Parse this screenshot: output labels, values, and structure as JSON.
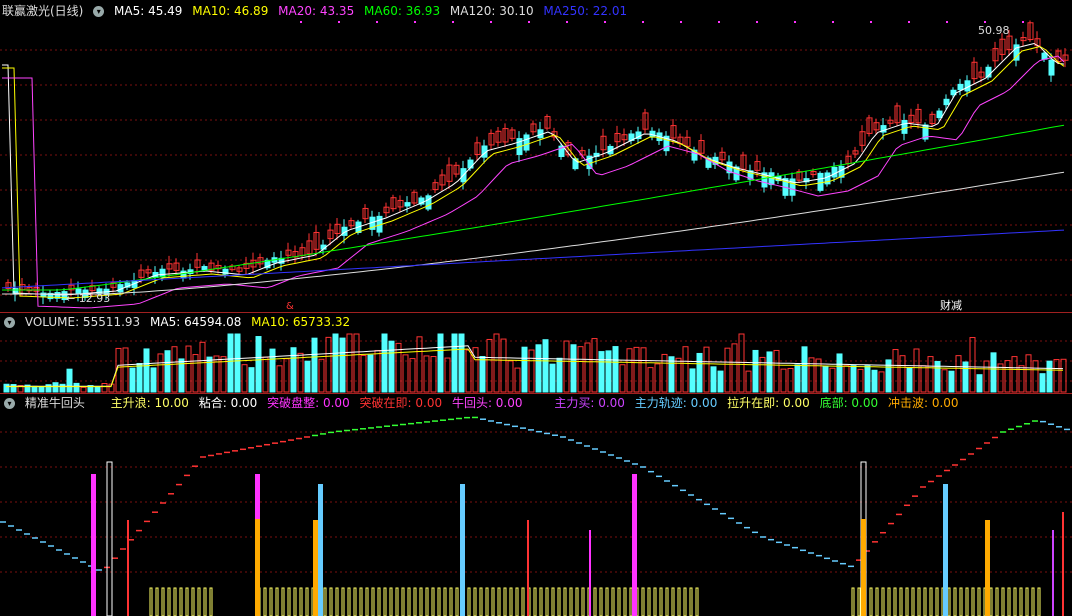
{
  "price_panel": {
    "title": "联赢激光(日线)",
    "ma": [
      {
        "label": "MA5: 45.49",
        "color": "#ffffff"
      },
      {
        "label": "MA10: 46.89",
        "color": "#ffff00"
      },
      {
        "label": "MA20: 43.35",
        "color": "#ff44ff"
      },
      {
        "label": "MA60: 36.93",
        "color": "#00ff00"
      },
      {
        "label": "MA120: 30.10",
        "color": "#dddddd"
      },
      {
        "label": "MA250: 22.01",
        "color": "#3333ff"
      }
    ],
    "high_label": "50.98",
    "low_label": "12.93",
    "marker_1": "&",
    "marker_2": "财减"
  },
  "volume_panel": {
    "items": [
      {
        "label": "VOLUME: 55511.93",
        "color": "#dddddd"
      },
      {
        "label": "MA5: 64594.08",
        "color": "#ffffff"
      },
      {
        "label": "MA10: 65733.32",
        "color": "#ffff00"
      }
    ]
  },
  "indicator_panel": {
    "name": "精准牛回头",
    "items": [
      {
        "label": "主升浪: 10.00",
        "color": "#ffff66"
      },
      {
        "label": "粘合: 0.00",
        "color": "#ffffff"
      },
      {
        "label": "突破盘整: 0.00",
        "color": "#ff33ff"
      },
      {
        "label": "突破在即: 0.00",
        "color": "#ff3333"
      },
      {
        "label": "牛回头: 0.00",
        "color": "#ff44ff"
      },
      {
        "label": "主力买: 0.00",
        "color": "#cc44ff"
      },
      {
        "label": "主力轨迹: 0.00",
        "color": "#66ccff"
      },
      {
        "label": "拉升在即: 0.00",
        "color": "#ffff66"
      },
      {
        "label": "底部: 0.00",
        "color": "#33ff33"
      },
      {
        "label": "冲击波: 0.00",
        "color": "#ffaa00"
      }
    ]
  },
  "colors": {
    "up": "#ff3333",
    "down": "#55ffff",
    "grid": "#7a1010"
  }
}
